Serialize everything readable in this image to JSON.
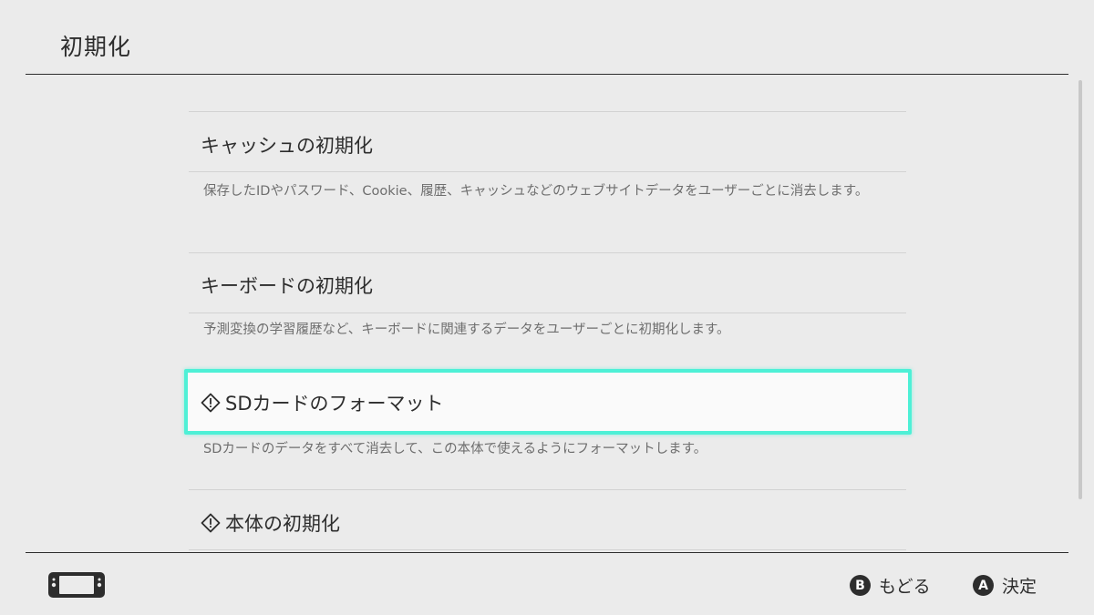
{
  "header": {
    "title": "初期化"
  },
  "items": [
    {
      "title": "キャッシュの初期化",
      "description": "保存したIDやパスワード、Cookie、履歴、キャッシュなどのウェブサイトデータをユーザーごとに消去します。",
      "warning": false
    },
    {
      "title": "キーボードの初期化",
      "description": "予測変換の学習履歴など、キーボードに関連するデータをユーザーごとに初期化します。",
      "warning": false
    },
    {
      "title": "SDカードのフォーマット",
      "description": "SDカードのデータをすべて消去して、この本体で使えるようにフォーマットします。",
      "warning": true,
      "selected": true
    },
    {
      "title": "本体の初期化",
      "description": "",
      "warning": true
    }
  ],
  "footer": {
    "back": {
      "button": "B",
      "label": "もどる"
    },
    "confirm": {
      "button": "A",
      "label": "決定"
    }
  },
  "colors": {
    "background": "#ebebeb",
    "selection": "#4ef0d6",
    "text": "#2d2d2d"
  },
  "icons": {
    "warning": "warning-diamond-icon",
    "console": "console-handheld-icon"
  }
}
